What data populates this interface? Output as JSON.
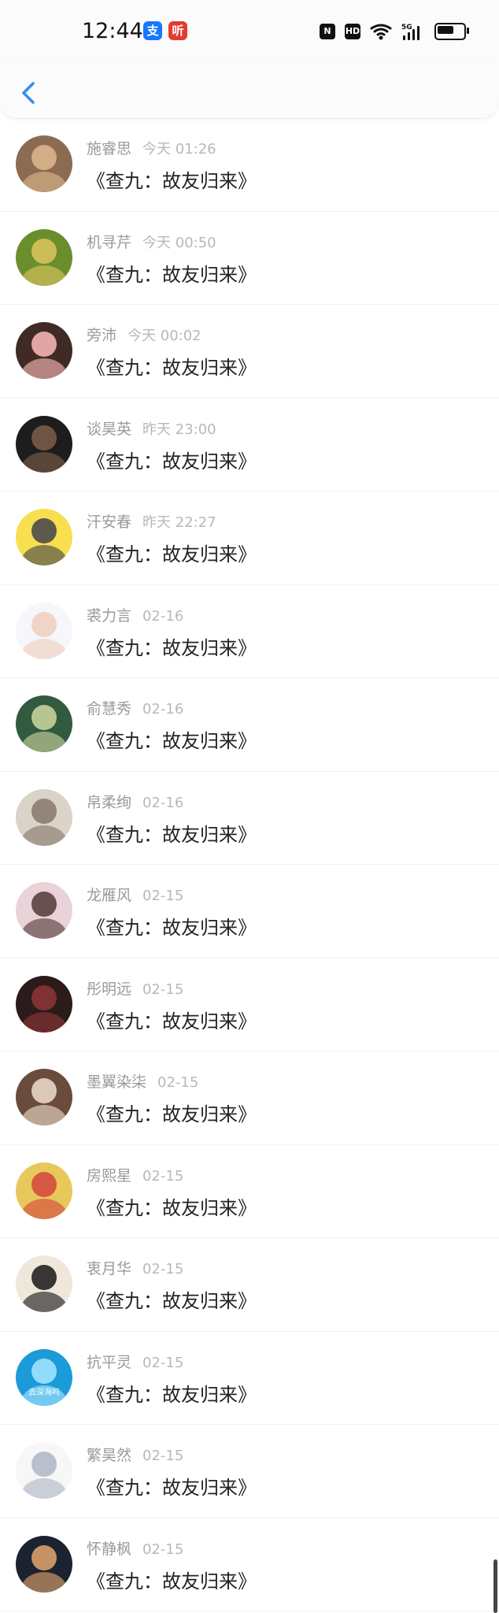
{
  "status_bar": {
    "time": "12:44",
    "apps": [
      {
        "name": "alipay-app-icon",
        "glyph": "支",
        "color": "#1677ff"
      },
      {
        "name": "listen-app-icon",
        "glyph": "听",
        "color": "#e23d2e"
      }
    ],
    "right_icons": [
      "nfc-icon",
      "hd-icon",
      "wifi-icon",
      "5g-signal-icon",
      "battery-icon"
    ],
    "nfc_glyph": "N",
    "hd_glyph": "HD"
  },
  "header": {
    "back_icon": "chevron-left-icon",
    "accent_color": "#2f8ff0"
  },
  "list": {
    "items": [
      {
        "name": "施睿思",
        "time": "今天 01:26",
        "content": "《查九：故友归来》",
        "avatar_color": "#8b6b52",
        "avatar_overlay": "#d9b58b"
      },
      {
        "name": "机寻芹",
        "time": "今天 00:50",
        "content": "《查九：故友归来》",
        "avatar_color": "#6b8e2d",
        "avatar_overlay": "#d7c35b"
      },
      {
        "name": "旁沛",
        "time": "今天 00:02",
        "content": "《查九：故友归来》",
        "avatar_color": "#3f2b23",
        "avatar_overlay": "#f2b3b3"
      },
      {
        "name": "谈昊英",
        "time": "昨天 23:00",
        "content": "《查九：故友归来》",
        "avatar_color": "#1d1d1d",
        "avatar_overlay": "#7a5b48"
      },
      {
        "name": "汗安春",
        "time": "昨天 22:27",
        "content": "《查九：故友归来》",
        "avatar_color": "#f7df4f",
        "avatar_overlay": "#4b4b4b"
      },
      {
        "name": "裘力言",
        "time": "02-16",
        "content": "《查九：故友归来》",
        "avatar_color": "#f5f7fb",
        "avatar_overlay": "#f0d0c0"
      },
      {
        "name": "俞慧秀",
        "time": "02-16",
        "content": "《查九：故友归来》",
        "avatar_color": "#315a3f",
        "avatar_overlay": "#c7d09a"
      },
      {
        "name": "帛柔绚",
        "time": "02-16",
        "content": "《查九：故友归来》",
        "avatar_color": "#d9d3c8",
        "avatar_overlay": "#8b7c6f"
      },
      {
        "name": "龙雁风",
        "time": "02-15",
        "content": "《查九：故友归来》",
        "avatar_color": "#e9d3d8",
        "avatar_overlay": "#5a4041"
      },
      {
        "name": "彤明远",
        "time": "02-15",
        "content": "《查九：故友归来》",
        "avatar_color": "#2b1b1b",
        "avatar_overlay": "#8a3434"
      },
      {
        "name": "墨翼染柒",
        "time": "02-15",
        "content": "《查九：故友归来》",
        "avatar_color": "#6b4b3c",
        "avatar_overlay": "#e7d7c4"
      },
      {
        "name": "房熙星",
        "time": "02-15",
        "content": "《查九：故友归来》",
        "avatar_color": "#e7c85b",
        "avatar_overlay": "#d54c3f"
      },
      {
        "name": "衷月华",
        "time": "02-15",
        "content": "《查九：故友归来》",
        "avatar_color": "#efe7d9",
        "avatar_overlay": "#222222"
      },
      {
        "name": "抗平灵",
        "time": "02-15",
        "content": "《查九：故友归来》",
        "avatar_color": "#1b9bd8",
        "avatar_overlay": "#9ee3ff",
        "avatar_text": "去深海吗"
      },
      {
        "name": "繁昊然",
        "time": "02-15",
        "content": "《查九：故友归来》",
        "avatar_color": "#f7f7f7",
        "avatar_overlay": "#b0b8c8"
      },
      {
        "name": "怀静枫",
        "time": "02-15",
        "content": "《查九：故友归来》",
        "avatar_color": "#1b2330",
        "avatar_overlay": "#d8a06a"
      }
    ]
  }
}
